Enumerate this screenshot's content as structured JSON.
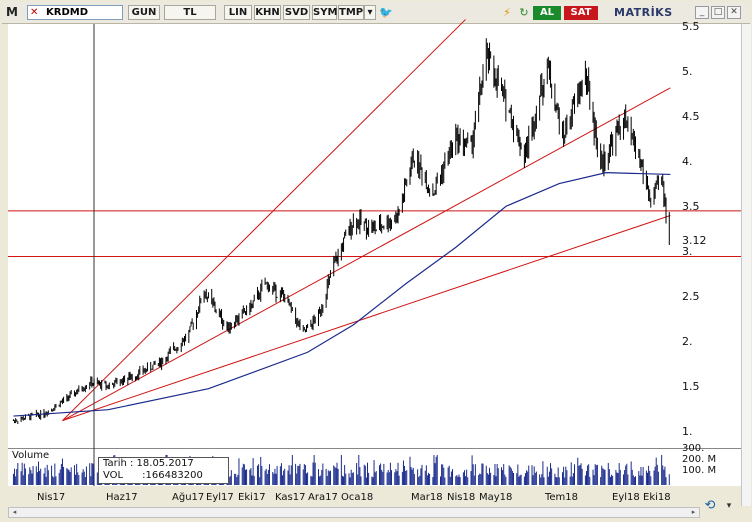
{
  "toolbar": {
    "app_letter": "M",
    "symbol": "KRDMD",
    "buttons": [
      "GUN",
      "TL",
      "LIN",
      "KHN",
      "SVD",
      "SYM",
      "TMP"
    ],
    "buy_label": "AL",
    "sell_label": "SAT",
    "brand": "MATRİKS"
  },
  "colors": {
    "candle": "#000000",
    "trendline": "#d01414",
    "ma": "#1a2b8c",
    "volume": "#1a2b8c",
    "buy": "#1a8a2a",
    "sell": "#c8161d"
  },
  "price_axis": {
    "labels": [
      "5.5",
      "5.",
      "4.5",
      "4.",
      "3.5",
      "3.12",
      "3.",
      "2.5",
      "2.",
      "1.5",
      "1."
    ]
  },
  "volume_panel": {
    "title": "Volume",
    "axis_labels": [
      "300.",
      "200. M",
      "100. M"
    ]
  },
  "tooltip": {
    "date_line": "Tarih : 18.05.2017",
    "vol_line": "VOL      :166483200"
  },
  "time_axis": {
    "labels": [
      "Nis17",
      "Haz17",
      "Ağu17",
      "Eyl17",
      "Eki17",
      "Kas17",
      "Ara17",
      "Oca18",
      "Mar18",
      "Nis18",
      "May18",
      "Tem18",
      "Eyl18",
      "Eki18"
    ]
  },
  "chart_data": {
    "type": "candlestick",
    "symbol": "KRDMD",
    "period": "daily",
    "x_range": [
      "2017-03",
      "2018-10"
    ],
    "ylim": [
      0.9,
      5.55
    ],
    "last_price": 3.12,
    "horizontal_lines": [
      3.5,
      3.0
    ],
    "price_path": [
      {
        "date": "2017-03-06",
        "close": 1.2
      },
      {
        "date": "2017-04-03",
        "close": 1.28
      },
      {
        "date": "2017-04-25",
        "close": 1.45
      },
      {
        "date": "2017-05-15",
        "close": 1.62
      },
      {
        "date": "2017-06-01",
        "close": 1.58
      },
      {
        "date": "2017-06-26",
        "close": 1.7
      },
      {
        "date": "2017-07-20",
        "close": 1.85
      },
      {
        "date": "2017-08-14",
        "close": 2.15
      },
      {
        "date": "2017-08-28",
        "close": 2.62
      },
      {
        "date": "2017-09-18",
        "close": 2.22
      },
      {
        "date": "2017-10-10",
        "close": 2.45
      },
      {
        "date": "2017-10-23",
        "close": 2.7
      },
      {
        "date": "2017-11-10",
        "close": 2.55
      },
      {
        "date": "2017-11-27",
        "close": 2.15
      },
      {
        "date": "2017-12-11",
        "close": 2.35
      },
      {
        "date": "2017-12-25",
        "close": 2.9
      },
      {
        "date": "2018-01-12",
        "close": 3.4
      },
      {
        "date": "2018-02-01",
        "close": 3.3
      },
      {
        "date": "2018-02-22",
        "close": 3.45
      },
      {
        "date": "2018-03-08",
        "close": 4.1
      },
      {
        "date": "2018-03-26",
        "close": 3.7
      },
      {
        "date": "2018-04-16",
        "close": 4.3
      },
      {
        "date": "2018-04-30",
        "close": 4.2
      },
      {
        "date": "2018-05-14",
        "close": 5.2
      },
      {
        "date": "2018-06-04",
        "close": 4.6
      },
      {
        "date": "2018-06-18",
        "close": 4.1
      },
      {
        "date": "2018-07-09",
        "close": 5.1
      },
      {
        "date": "2018-07-23",
        "close": 4.3
      },
      {
        "date": "2018-08-13",
        "close": 5.0
      },
      {
        "date": "2018-08-27",
        "close": 4.0
      },
      {
        "date": "2018-09-17",
        "close": 4.5
      },
      {
        "date": "2018-10-01",
        "close": 4.1
      },
      {
        "date": "2018-10-12",
        "close": 3.6
      },
      {
        "date": "2018-10-22",
        "close": 3.85
      },
      {
        "date": "2018-10-30",
        "close": 3.12
      }
    ],
    "moving_average": [
      {
        "date": "2017-03-06",
        "value": 1.25
      },
      {
        "date": "2017-06-01",
        "value": 1.32
      },
      {
        "date": "2017-09-01",
        "value": 1.55
      },
      {
        "date": "2017-12-01",
        "value": 1.95
      },
      {
        "date": "2018-01-12",
        "value": 2.25
      },
      {
        "date": "2018-03-01",
        "value": 2.7
      },
      {
        "date": "2018-04-16",
        "value": 3.1
      },
      {
        "date": "2018-06-01",
        "value": 3.55
      },
      {
        "date": "2018-07-20",
        "value": 3.8
      },
      {
        "date": "2018-09-01",
        "value": 3.92
      },
      {
        "date": "2018-10-30",
        "value": 3.9
      }
    ],
    "trendlines": [
      {
        "from": {
          "date": "2017-04-20",
          "price": 1.2
        },
        "to": {
          "date": "2018-04-25",
          "price": 5.6
        }
      },
      {
        "from": {
          "date": "2017-04-20",
          "price": 1.2
        },
        "to": {
          "date": "2018-10-30",
          "price": 4.85
        }
      },
      {
        "from": {
          "date": "2017-04-20",
          "price": 1.2
        },
        "to": {
          "date": "2018-10-30",
          "price": 3.45
        }
      }
    ],
    "volume": {
      "unit": "M",
      "max": 300
    }
  }
}
